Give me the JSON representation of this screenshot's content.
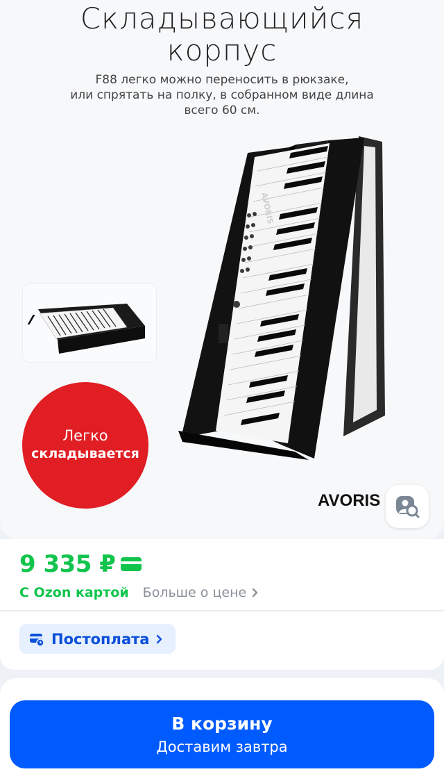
{
  "hero": {
    "title_line1": "Складывающийся",
    "title_line2": "корпус",
    "desc_line1": "F88 легко можно переносить в рюкзаке,",
    "desc_line2": "или спрятать на полку, в собранном виде длина",
    "desc_line3": "всего 60 см.",
    "badge_line1": "Легко",
    "badge_line2": "складывается",
    "brand": "AVORIS",
    "piano_brand_mark": "AVORIS"
  },
  "price": {
    "value": "9 335 ₽",
    "ozon_card_label": "С Ozon картой",
    "more_label": "Больше о цене"
  },
  "payment": {
    "postpay_label": "Постоплата"
  },
  "cart": {
    "button_label": "В корзину",
    "delivery_label": "Доставим завтра"
  },
  "colors": {
    "accent_blue": "#005bff",
    "price_green": "#10c44c",
    "badge_red": "#e01e24"
  },
  "icons": {
    "card": "card-icon",
    "chevron": "chevron-right-icon",
    "postpay": "postpay-card-icon",
    "image_search": "image-search-icon"
  }
}
